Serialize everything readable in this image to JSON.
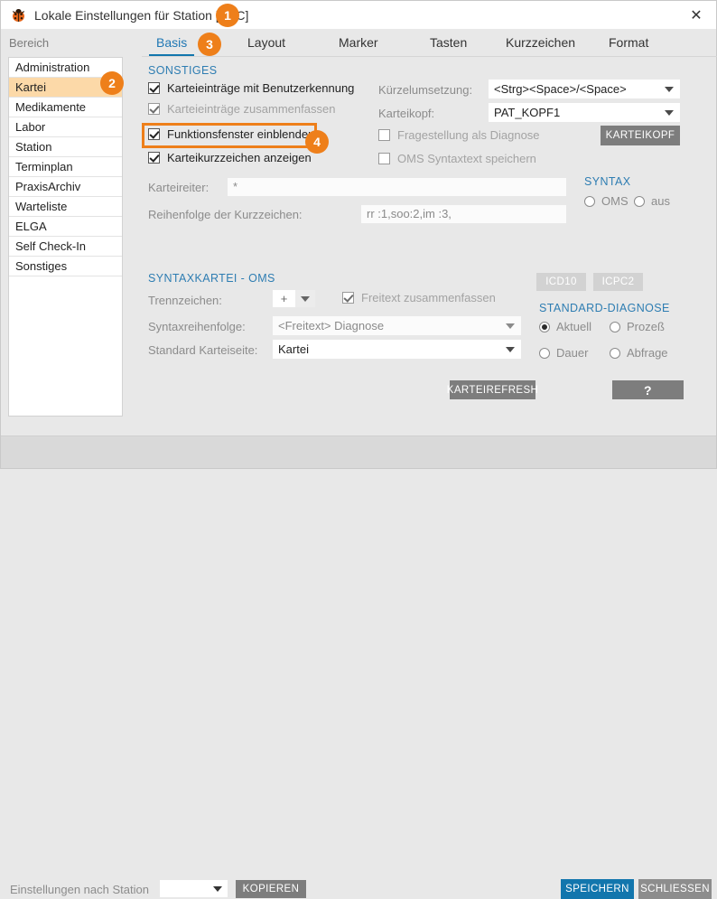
{
  "window": {
    "title": "Lokale Einstellungen für Station [LOC]",
    "app_icon": "ladybug-icon",
    "close_label": "✕"
  },
  "sidebar": {
    "header": "Bereich",
    "items": [
      {
        "label": "Administration",
        "selected": false
      },
      {
        "label": "Kartei",
        "selected": true
      },
      {
        "label": "Medikamente",
        "selected": false
      },
      {
        "label": "Labor",
        "selected": false
      },
      {
        "label": "Station",
        "selected": false
      },
      {
        "label": "Terminplan",
        "selected": false
      },
      {
        "label": "PraxisArchiv",
        "selected": false
      },
      {
        "label": "Warteliste",
        "selected": false
      },
      {
        "label": "ELGA",
        "selected": false
      },
      {
        "label": "Self Check-In",
        "selected": false
      },
      {
        "label": "Sonstiges",
        "selected": false
      }
    ]
  },
  "tabs": [
    {
      "label": "Basis",
      "active": true
    },
    {
      "label": "Layout",
      "active": false
    },
    {
      "label": "Marker",
      "active": false
    },
    {
      "label": "Tasten",
      "active": false
    },
    {
      "label": "Kurzzeichen",
      "active": false
    },
    {
      "label": "Format",
      "active": false
    }
  ],
  "sonstiges": {
    "title": "SONSTIGES",
    "checkboxes": [
      {
        "label": "Karteieinträge mit Benutzerkennung",
        "checked": true,
        "disabled": false
      },
      {
        "label": "Karteieinträge zusammenfassen",
        "checked": true,
        "disabled": true
      },
      {
        "label": "Funktionsfenster einblenden",
        "checked": true,
        "disabled": false
      },
      {
        "label": "Karteikurzzeichen anzeigen",
        "checked": true,
        "disabled": false
      }
    ]
  },
  "right_panel": {
    "kuerzel_label": "Kürzelumsetzung:",
    "kuerzel_value": "<Strg><Space>/<Space>",
    "karteikopf_label": "Karteikopf:",
    "karteikopf_value": "PAT_KOPF1",
    "karteikopf_button": "KARTEIKOPF",
    "checkboxes": [
      {
        "label": "Fragestellung als Diagnose",
        "checked": false,
        "disabled": true
      },
      {
        "label": "OMS Syntaxtext speichern",
        "checked": false,
        "disabled": true
      }
    ],
    "syntax_title": "SYNTAX",
    "syntax_options": [
      {
        "label": "OMS",
        "selected": false
      },
      {
        "label": "aus",
        "selected": false
      }
    ]
  },
  "fields": {
    "karteireiter_label": "Karteireiter:",
    "karteireiter_value": "*",
    "reihenfolge_label": "Reihenfolge der Kurzzeichen:",
    "reihenfolge_value": "rr :1,soo:2,im :3,"
  },
  "syntaxkartei": {
    "title": "SYNTAXKARTEI - OMS",
    "trennzeichen_label": "Trennzeichen:",
    "trennzeichen_value": "+",
    "freitext_checkbox": {
      "label": "Freitext zusammenfassen",
      "checked": true,
      "disabled": true
    },
    "syntaxreihenfolge_label": "Syntaxreihenfolge:",
    "syntaxreihenfolge_value": "<Freitext> Diagnose",
    "standard_karteiseite_label": "Standard Karteiseite:",
    "standard_karteiseite_value": "Kartei"
  },
  "diagnose": {
    "icd10_button": "ICD10",
    "icpc2_button": "ICPC2",
    "title": "STANDARD-DIAGNOSE",
    "options": [
      {
        "label": "Aktuell",
        "selected": true
      },
      {
        "label": "Prozeß",
        "selected": false
      },
      {
        "label": "Dauer",
        "selected": false
      },
      {
        "label": "Abfrage",
        "selected": false
      }
    ]
  },
  "actions": {
    "karteirefresh_button": "KARTEIREFRESH",
    "help_button": "?"
  },
  "footer": {
    "copy_label": "Einstellungen nach Station",
    "station_value": "",
    "copy_button": "KOPIEREN",
    "save_button": "SPEICHERN",
    "close_button": "SCHLIESSEN"
  },
  "annotations": {
    "badge1": "1",
    "badge2": "2",
    "badge3": "3",
    "badge4": "4",
    "accent_color": "#ee7f1a"
  }
}
